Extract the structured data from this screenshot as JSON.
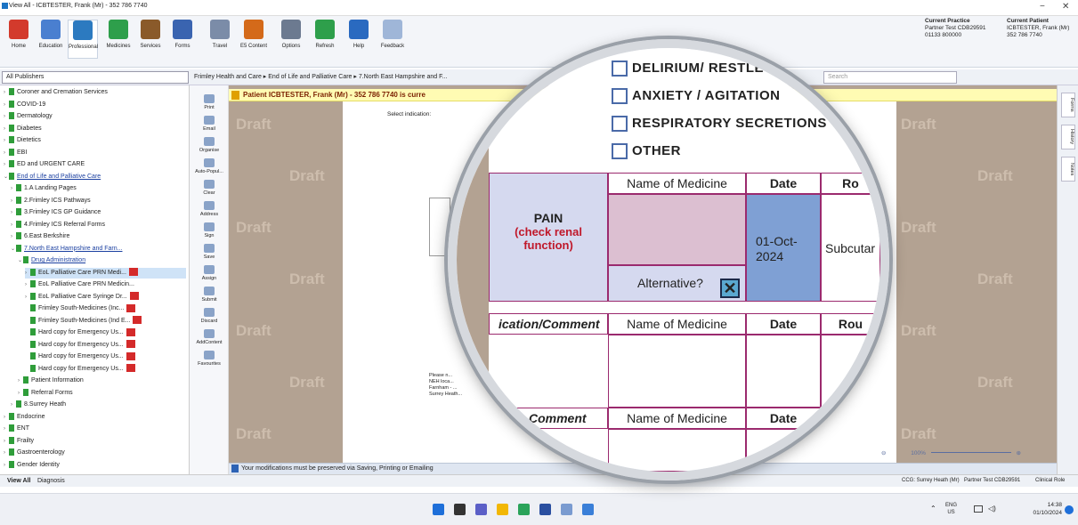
{
  "window": {
    "title": "View All - ICBTESTER, Frank (Mr) - 352 786 7740",
    "minimize": "−",
    "close": "✕"
  },
  "ribbon": {
    "buttons": [
      {
        "label": "Home",
        "icon": "home-icon",
        "color": "#d33a2c"
      },
      {
        "label": "Education",
        "icon": "education-icon",
        "color": "#4a7fd0"
      },
      {
        "label": "Professional",
        "icon": "professional-icon",
        "color": "#2c7ac0"
      },
      {
        "label": "Medicines",
        "icon": "medicines-icon",
        "color": "#2e9f4b"
      },
      {
        "label": "Services",
        "icon": "services-icon",
        "color": "#8a5a2a"
      },
      {
        "label": "Forms",
        "icon": "forms-icon",
        "color": "#3a64b0"
      },
      {
        "label": "Travel",
        "icon": "travel-icon",
        "color": "#7b8ca8"
      },
      {
        "label": "E5 Content",
        "icon": "content-icon",
        "color": "#d46a1a"
      },
      {
        "label": "Options",
        "icon": "options-icon",
        "color": "#6c7a90"
      },
      {
        "label": "Refresh",
        "icon": "refresh-icon",
        "color": "#2e9f4b"
      },
      {
        "label": "Help",
        "icon": "help-icon",
        "color": "#2a6ac0"
      },
      {
        "label": "Feedback",
        "icon": "feedback-icon",
        "color": "#9fb6d8"
      }
    ],
    "practice_label": "Current Practice",
    "practice_name": "Partner Test CDB29591",
    "practice_phone": "01133 800000",
    "patient_label": "Current Patient",
    "patient_name": "ICBTESTER, Frank (Mr)",
    "patient_phone": "352 786 7740"
  },
  "nav": {
    "publisher": "All Publishers",
    "breadcrumb": "Frimley Health and Care ▸ End of Life and Palliative Care ▸ 7.North East Hampshire and F...",
    "search_placeholder": "Search"
  },
  "tree": [
    {
      "label": "Coroner and Cremation Services",
      "level": 1,
      "chev": "›"
    },
    {
      "label": "COVID-19",
      "level": 1,
      "chev": "›"
    },
    {
      "label": "Dermatology",
      "level": 1,
      "chev": "›"
    },
    {
      "label": "Diabetes",
      "level": 1,
      "chev": "›"
    },
    {
      "label": "Dietetics",
      "level": 1,
      "chev": "›"
    },
    {
      "label": "EBI",
      "level": 1,
      "chev": "›"
    },
    {
      "label": "ED and URGENT CARE",
      "level": 1,
      "chev": "›"
    },
    {
      "label": "End of Life and Palliative Care",
      "level": 1,
      "chev": "⌄",
      "link": true
    },
    {
      "label": "1.A Landing Pages",
      "level": 2,
      "chev": "›"
    },
    {
      "label": "2.Frimley ICS Pathways",
      "level": 2,
      "chev": "›"
    },
    {
      "label": "3.Frimley ICS GP Guidance",
      "level": 2,
      "chev": "›"
    },
    {
      "label": "4.Frimley ICS Referral Forms",
      "level": 2,
      "chev": "›"
    },
    {
      "label": "6.East Berkshire",
      "level": 2,
      "chev": "›"
    },
    {
      "label": "7.North East Hampshire and Farn...",
      "level": 2,
      "chev": "⌄",
      "link": true
    },
    {
      "label": "Drug Administration",
      "level": 3,
      "chev": "⌄",
      "link": true
    },
    {
      "label": "EoL Palliative Care PRN Medi...",
      "level": 4,
      "chev": "›",
      "pdf": true,
      "selected": true
    },
    {
      "label": "EoL Palliative Care PRN Medicin...",
      "level": 4,
      "chev": "›"
    },
    {
      "label": "EoL Palliative Care Syringe Dr...",
      "level": 4,
      "chev": "›",
      "pdf": true
    },
    {
      "label": "Frimley South-Medicines (Inc...",
      "level": 4,
      "chev": "",
      "pdf": true
    },
    {
      "label": "Frimley South-Medicines (Ind E...",
      "level": 4,
      "chev": "",
      "pdf": true
    },
    {
      "label": "Hard copy for Emergency Us...",
      "level": 4,
      "chev": "",
      "pdf": true
    },
    {
      "label": "Hard copy for Emergency Us...",
      "level": 4,
      "chev": "",
      "pdf": true
    },
    {
      "label": "Hard copy for Emergency Us...",
      "level": 4,
      "chev": "",
      "pdf": true
    },
    {
      "label": "Hard copy for Emergency Us...",
      "level": 4,
      "chev": "",
      "pdf": true
    },
    {
      "label": "Patient Information",
      "level": 3,
      "chev": "›"
    },
    {
      "label": "Referral Forms",
      "level": 3,
      "chev": "›"
    },
    {
      "label": "8.Surrey Heath",
      "level": 2,
      "chev": "›"
    },
    {
      "label": "Endocrine",
      "level": 1,
      "chev": "›"
    },
    {
      "label": "ENT",
      "level": 1,
      "chev": "›"
    },
    {
      "label": "Frailty",
      "level": 1,
      "chev": "›"
    },
    {
      "label": "Gastroenterology",
      "level": 1,
      "chev": "›"
    },
    {
      "label": "Gender Identity",
      "level": 1,
      "chev": "›"
    }
  ],
  "tools": [
    "Print",
    "Email",
    "Organise",
    "Auto-Popul...",
    "Clear",
    "Address",
    "Sign",
    "Save",
    "Assign",
    "Submit",
    "Discard",
    "AddContent",
    "Favourites"
  ],
  "bottom_tabs": {
    "view_all": "View All",
    "diagnosis": "Diagnosis"
  },
  "banner": "Patient ICBTESTER, Frank (Mr) - 352 786 7740 is curre",
  "draft_watermark": "Draft",
  "page": {
    "select_indication": "Select indication:",
    "please_note": "Please n...",
    "neh": "NEH loca...",
    "farnham": "Farnham - ...",
    "surrey": "Surrey Heath..."
  },
  "side_tabs": [
    "Forms",
    "History",
    "Notes"
  ],
  "status": {
    "message": "Your modifications must be preserved via Saving, Printing or Emailing",
    "zoom": "100%",
    "bottom_ccg": "CCG: Surrey Heath (Mr)",
    "bottom_practice": "Partner Test CDB29591",
    "bottom_role": "Clinical Role"
  },
  "magnifier": {
    "partial_top": "DELIRIUM/ RESTLE...",
    "options": [
      "DELIRIUM/ RESTLE",
      "ANXIETY / AGITATION",
      "RESPIRATORY SECRETIONS",
      "OTHER"
    ],
    "col_medicine": "Name of Medicine",
    "col_date": "Date",
    "col_route": "Ro",
    "pain_label": "PAIN",
    "pain_sub": "(check renal function)",
    "date_value": "01-Oct-2024",
    "route_value": "Subcutar",
    "alternative": "Alternative?",
    "indication_comment": "ication/Comment",
    "comment": "Comment",
    "col_route2": "Rou"
  },
  "taskbar": {
    "lang": "ENG",
    "region": "US",
    "time": "14:38",
    "date": "01/10/2024"
  }
}
